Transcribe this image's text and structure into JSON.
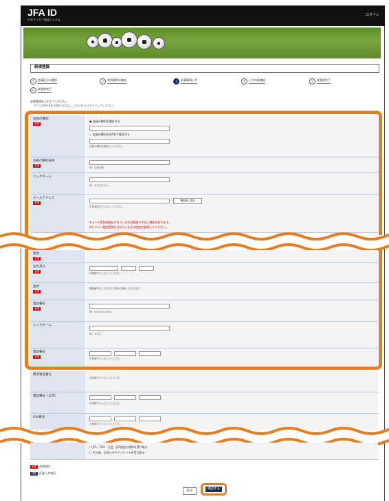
{
  "header": {
    "logo": "JFA ID",
    "logo_sub": "日本サッカー協会システム",
    "link": "ログイン"
  },
  "page": {
    "title": "新規登録",
    "instruction": "必要事項を入力してください。",
    "instruction_sub": "すでにJFA IDをお持ちの方は、こちらからログインしてください。"
  },
  "steps": [
    {
      "num": "1",
      "label": "会員区分の選択"
    },
    {
      "num": "2",
      "label": "利用規約の確認"
    },
    {
      "num": "3",
      "label": "必要事項入力"
    },
    {
      "num": "4",
      "label": "入力内容確認"
    },
    {
      "num": "5",
      "label": "仮登録完了"
    },
    {
      "num": "6",
      "label": "本登録完了"
    }
  ],
  "form": {
    "rows": [
      {
        "label": "会員の種別",
        "required": "必須",
        "note": "会員の種別を選択してください"
      },
      {
        "label": "会員の種別名称",
        "required": "必須",
        "note": "例：山田太郎"
      },
      {
        "label": "ニックネーム",
        "required": "",
        "note": "例：やまだたろう"
      },
      {
        "label": "メールアドレス",
        "required": "必須",
        "note": "半角英数字で入力してください"
      },
      {
        "label": "性別",
        "required": "必須",
        "note": ""
      },
      {
        "label": "生年月日",
        "required": "必須",
        "note": "半角数字で入力してください"
      },
      {
        "label": "住所",
        "required": "必須",
        "note": "郵便番号を入力すると住所が自動入力されます"
      },
      {
        "label": "電話番号",
        "required": "必須",
        "note": "例：03-0000-0000"
      },
      {
        "label": "ニックネーム",
        "required": "",
        "note": "例：やまだ"
      },
      {
        "label": "電話番号",
        "required": "必須",
        "note": "半角数字で入力してください"
      }
    ],
    "radio1": "会員の種別を選択する",
    "radio2": "会員の種別をJFAIDで登録する",
    "email_button": "確認用に送信",
    "warn1": "※メール受信制限をされている方は登録できない場合があります。",
    "warn2": "※ドメイン指定受信をされている方は設定を解除してください。"
  },
  "lower": {
    "rows": [
      {
        "label": "携帯電話番号",
        "note": "半角数字で入力してください"
      },
      {
        "label": "電話番号（自宅）",
        "note": "半角数字で入力してください"
      },
      {
        "label": "FAX番号",
        "note": "半角数字で入力してください"
      }
    ],
    "check1": "JFA・FIFA・大会・JFA協会の通知を受け取る",
    "check2": "その他、お知らせやアンケートを受け取る"
  },
  "legend": {
    "required_tag": "必須",
    "required_text": "必須項目",
    "optional_tag": "任意",
    "optional_text": "任意入力項目"
  },
  "buttons": {
    "back": "戻る",
    "confirm": "確認する"
  },
  "colors": {
    "accent": "#e57d23",
    "navy": "#1a2b5c",
    "required": "#cc0000"
  }
}
